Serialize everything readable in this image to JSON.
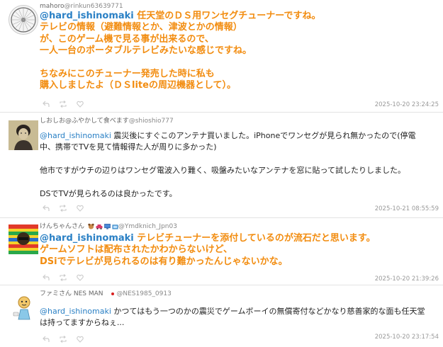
{
  "posts": [
    {
      "author": "mahoro",
      "handle": "@rinkun63639771",
      "mention": "@hard_ishinomaki",
      "lines": [
        " 任天堂のＤＳ用ワンセグチューナーですね。",
        "テレビの情報（避難情報とか、津波とかの情報）",
        "が、このゲーム機で見る事が出来るので、",
        "一人一台のポータブルテレビみたいな感じですね。",
        "",
        "ちなみにこのチューナー発売した時に私も",
        "購入しましたよ（ＤＳliteの周辺機器として）。"
      ],
      "timestamp": "2025-10-20 23:24:25"
    },
    {
      "author": "しおしお@ふやかして食べます",
      "handle": "@shioshio777",
      "mention": "@hard_ishinomaki",
      "lines": [
        " 震災後にすぐこのアンテナ買いました。iPhoneでワンセグが見られ無かったので(停電",
        "中、携帯でTVを見て情報得た人が周りに多かった)",
        "",
        "他市ですがウチの辺りはワンセグ電波入り難く、吸盤みたいなアンテナを窓に貼って試したりしました。",
        "",
        "DSでTVが見られるのは良かったです。"
      ],
      "timestamp": "2025-10-21 08:55:59"
    },
    {
      "author": "けんちゃんさん",
      "handle": "@Ymdknich_Jpn03",
      "mention": "@hard_ishinomaki",
      "lines": [
        " テレビチューナーを添付しているのが流石だと思います。",
        "ゲームソフトは配布されたかわからないけど、",
        "DSiでテレビが見られるのは有り難かったんじゃないかな。"
      ],
      "timestamp": "2025-10-20 21:39:26"
    },
    {
      "author": "ファミさん NES MAN",
      "handle": "@NES1985_0913",
      "mention": "@hard_ishinomaki",
      "lines": [
        " かつてはもう一つのかの震災でゲームボーイの無償寄付などかなり慈善家的な面も任天堂",
        "は持ってますからねぇ..."
      ],
      "timestamp": "2025-10-20 23:17:54"
    }
  ],
  "icons": [
    "reply-icon",
    "retweet-icon",
    "like-icon"
  ]
}
